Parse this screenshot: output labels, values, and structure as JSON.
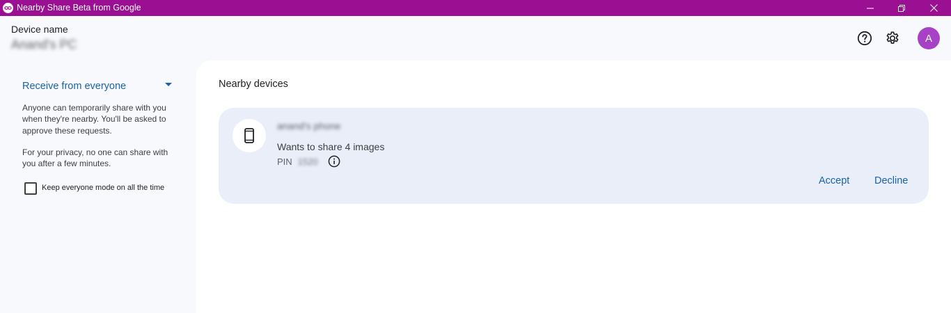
{
  "window": {
    "title": "Nearby Share Beta from Google",
    "colors": {
      "titlebar": "#9b0f93",
      "accent": "#1b62a8",
      "avatar": "#a742c7"
    }
  },
  "header": {
    "device_label": "Device name",
    "device_name": "Anand's PC",
    "avatar_initial": "A"
  },
  "sidebar": {
    "receive_option": "Receive from everyone",
    "description": "Anyone can temporarily share with you when they're nearby. You'll be asked to approve these requests.",
    "privacy_note": "For your privacy, no one can share with you after a few minutes.",
    "keep_mode_label": "Keep everyone mode on all the time"
  },
  "main": {
    "section_title": "Nearby devices",
    "request": {
      "device_name": "anand's phone",
      "message": "Wants to share 4 images",
      "pin_label": "PIN",
      "pin_value": "1520",
      "accept_label": "Accept",
      "decline_label": "Decline"
    }
  },
  "icons": [
    "app-icon",
    "minimize-icon",
    "maximize-icon",
    "close-icon",
    "help-icon",
    "gear-icon",
    "caret-down-icon",
    "checkbox-icon",
    "phone-icon",
    "info-icon"
  ]
}
